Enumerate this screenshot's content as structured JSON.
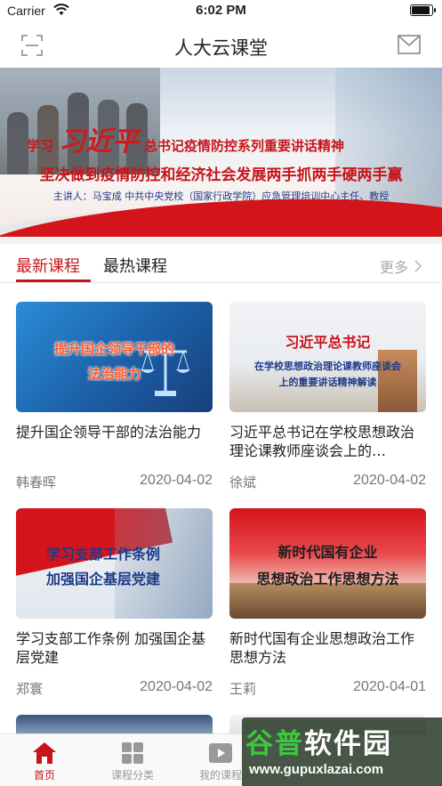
{
  "status_bar": {
    "carrier": "Carrier",
    "time": "6:02 PM"
  },
  "nav": {
    "title": "人大云课堂",
    "left_icon": "scan-icon",
    "right_icon": "mail-icon"
  },
  "banner": {
    "line1_prefix": "学习",
    "line1_name": "习近平",
    "line1_rest": "总书记疫情防控系列重要讲话精神",
    "line2": "坚决做到疫情防控和经济社会发展两手抓两手硬两手赢",
    "line3": "主讲人：马宝成 中共中央党校（国家行政学院）应急管理培训中心主任、教授"
  },
  "tabs": {
    "active": "最新课程",
    "inactive": "最热课程",
    "more": "更多"
  },
  "courses": [
    {
      "thumb_lines": [
        "提升国企领导干部的",
        "法治能力"
      ],
      "title": "提升国企领导干部的法治能力",
      "author": "韩春晖",
      "date": "2020-04-02"
    },
    {
      "thumb_lines": [
        "习近平总书记",
        "在学校思想政治理论课教师座谈会",
        "上的重要讲话精神解读"
      ],
      "title": "习近平总书记在学校思想政治理论课教师座谈会上的…",
      "author": "徐斌",
      "date": "2020-04-02"
    },
    {
      "thumb_lines": [
        "学习支部工作条例",
        "加强国企基层党建"
      ],
      "title": "学习支部工作条例  加强国企基层党建",
      "author": "郑寰",
      "date": "2020-04-02"
    },
    {
      "thumb_lines": [
        "新时代国有企业",
        "思想政治工作思想方法"
      ],
      "title": "新时代国有企业思想政治工作思想方法",
      "author": "王莉",
      "date": "2020-04-01"
    }
  ],
  "tabbar": [
    {
      "label": "首页",
      "icon": "home-icon",
      "active": true
    },
    {
      "label": "课程分类",
      "icon": "grid-icon",
      "active": false
    },
    {
      "label": "我的课程",
      "icon": "play-icon",
      "active": false
    }
  ],
  "watermark": {
    "line1_a": "谷普",
    "line1_b": "软件园",
    "line2": "www.gupuxlazai.com"
  },
  "colors": {
    "accent": "#c8151b",
    "muted": "#999999"
  }
}
